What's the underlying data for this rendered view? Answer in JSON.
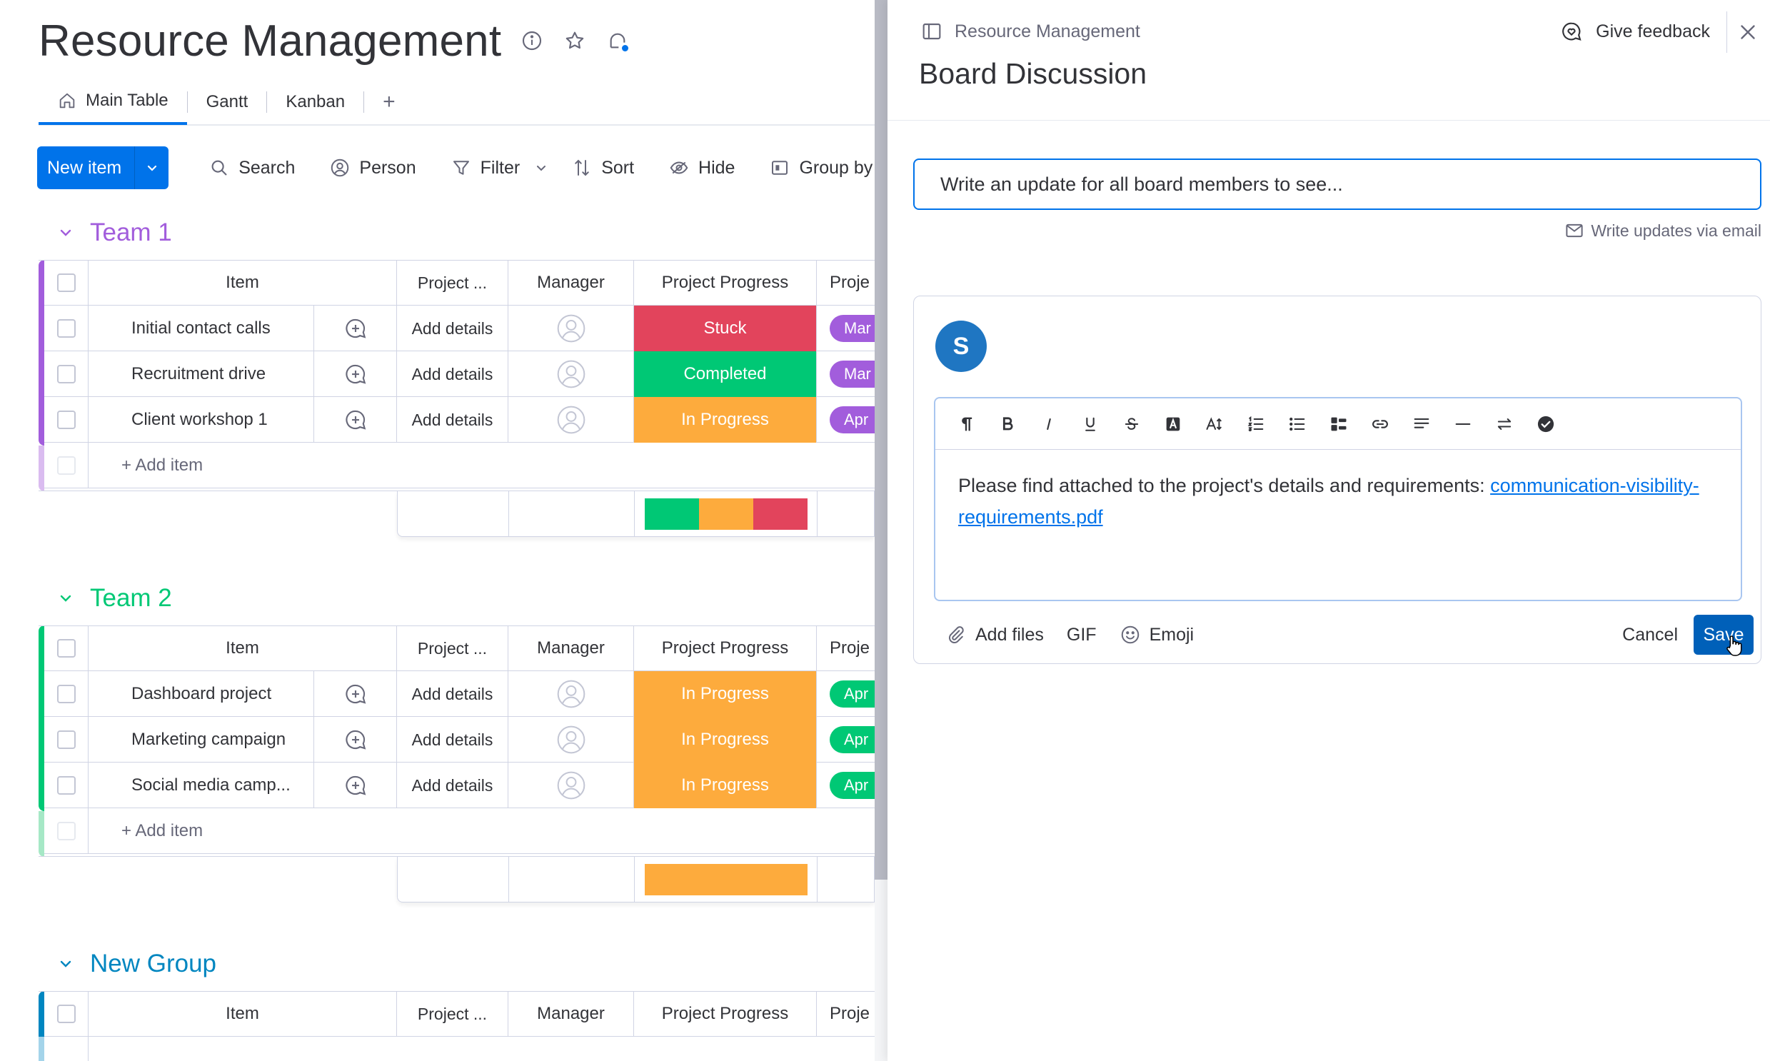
{
  "board": {
    "title": "Resource Management",
    "tabs": [
      {
        "label": "Main Table"
      },
      {
        "label": "Gantt"
      },
      {
        "label": "Kanban"
      }
    ],
    "tab_add": "+",
    "toolbar": {
      "new_item": "New item",
      "search": "Search",
      "person": "Person",
      "filter": "Filter",
      "sort": "Sort",
      "hide": "Hide",
      "group_by": "Group by"
    },
    "columns": {
      "item": "Item",
      "project": "Project ...",
      "manager": "Manager",
      "progress": "Project Progress",
      "proj2": "Proje"
    },
    "add_item": "+ Add item",
    "add_details": "Add details",
    "groups": [
      {
        "title": "Team 1",
        "color": "#a25ddc",
        "rows": [
          {
            "item": "Initial contact calls",
            "status": "Stuck",
            "status_color": "#e2445c",
            "tag": "Mar",
            "tag_color": "#a25ddc"
          },
          {
            "item": "Recruitment drive",
            "status": "Completed",
            "status_color": "#00c875",
            "tag": "Mar",
            "tag_color": "#a25ddc"
          },
          {
            "item": "Client workshop 1",
            "status": "In Progress",
            "status_color": "#fdab3d",
            "tag": "Apr",
            "tag_color": "#a25ddc"
          }
        ],
        "summary": [
          {
            "color": "#00c875",
            "share": 0.333
          },
          {
            "color": "#fdab3d",
            "share": 0.333
          },
          {
            "color": "#e2445c",
            "share": 0.334
          }
        ]
      },
      {
        "title": "Team 2",
        "color": "#00c875",
        "rows": [
          {
            "item": "Dashboard project",
            "status": "In Progress",
            "status_color": "#fdab3d",
            "tag": "Apr",
            "tag_color": "#00c875"
          },
          {
            "item": "Marketing campaign",
            "status": "In Progress",
            "status_color": "#fdab3d",
            "tag": "Apr",
            "tag_color": "#00c875"
          },
          {
            "item": "Social media camp...",
            "status": "In Progress",
            "status_color": "#fdab3d",
            "tag": "Apr",
            "tag_color": "#00c875"
          }
        ],
        "summary": [
          {
            "color": "#fdab3d",
            "share": 1.0
          }
        ]
      },
      {
        "title": "New Group",
        "color": "#0086c0",
        "rows": [],
        "summary": []
      }
    ]
  },
  "panel": {
    "breadcrumb": "Resource Management",
    "title": "Board Discussion",
    "feedback": "Give feedback",
    "update_placeholder": "Write an update for all board members to see...",
    "via_email": "Write updates via email",
    "author_initial": "S",
    "editor_text": "Please find attached to the project's details and requirements: ",
    "editor_link": "communication-visibility-requirements.pdf",
    "footer": {
      "add_files": "Add files",
      "gif": "GIF",
      "emoji": "Emoji",
      "cancel": "Cancel",
      "save": "Save"
    }
  }
}
